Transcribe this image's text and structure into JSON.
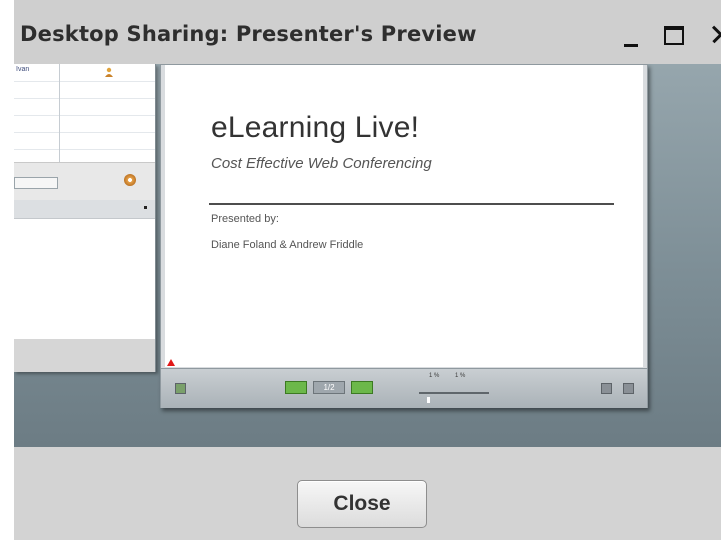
{
  "window": {
    "title": "Desktop Sharing: Presenter's Preview"
  },
  "shared_screen": {
    "left_panel": {
      "table_first_cell": "Ivan"
    },
    "slide": {
      "title": "eLearning Live!",
      "subtitle": "Cost Effective Web Conferencing",
      "presented_by_label": "Presented by:",
      "presenters": "Diane Foland & Andrew Friddle"
    },
    "controls": {
      "page": "1/2",
      "zoom_label_left": "1 %",
      "zoom_label_right": "1 %"
    }
  },
  "footer": {
    "close_label": "Close"
  }
}
